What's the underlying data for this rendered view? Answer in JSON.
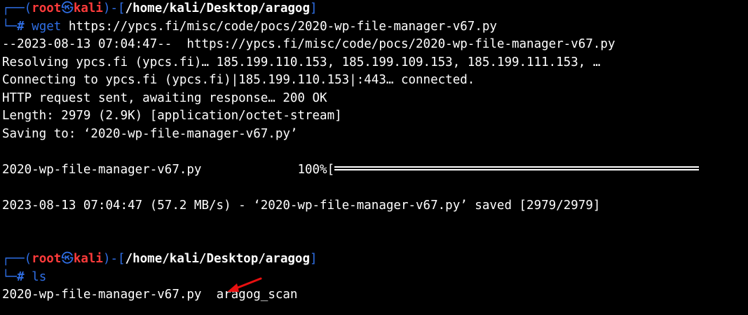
{
  "prompt": {
    "user": "root",
    "skull": "㉿",
    "host": "kali",
    "path": "/home/kali/Desktop/aragog",
    "hash": "#"
  },
  "session": {
    "cmd1": "wget",
    "cmd1_args": " https://ypcs.fi/misc/code/pocs/2020-wp-file-manager-v67.py",
    "out": [
      "--2023-08-13 07:04:47--  https://ypcs.fi/misc/code/pocs/2020-wp-file-manager-v67.py",
      "Resolving ypcs.fi (ypcs.fi)… 185.199.110.153, 185.199.109.153, 185.199.111.153, …",
      "Connecting to ypcs.fi (ypcs.fi)|185.199.110.153|:443… connected.",
      "HTTP request sent, awaiting response… 200 OK",
      "Length: 2979 (2.9K) [application/octet-stream]",
      "Saving to: ‘2020-wp-file-manager-v67.py’"
    ],
    "progress_file": "2020-wp-file-manager-v67.py",
    "progress_pct": "100%[",
    "progress_value": 1.0,
    "saved_line": "2023-08-13 07:04:47 (57.2 MB/s) - ‘2020-wp-file-manager-v67.py’ saved [2979/2979]",
    "cmd2": "ls",
    "ls_file1": "2020-wp-file-manager-v67.py",
    "ls_file2": "aragog_scan"
  },
  "colors": {
    "prompt_frame": "#2f6fe6",
    "user_host": "#ff3b3b",
    "arrow": "#e81010"
  }
}
